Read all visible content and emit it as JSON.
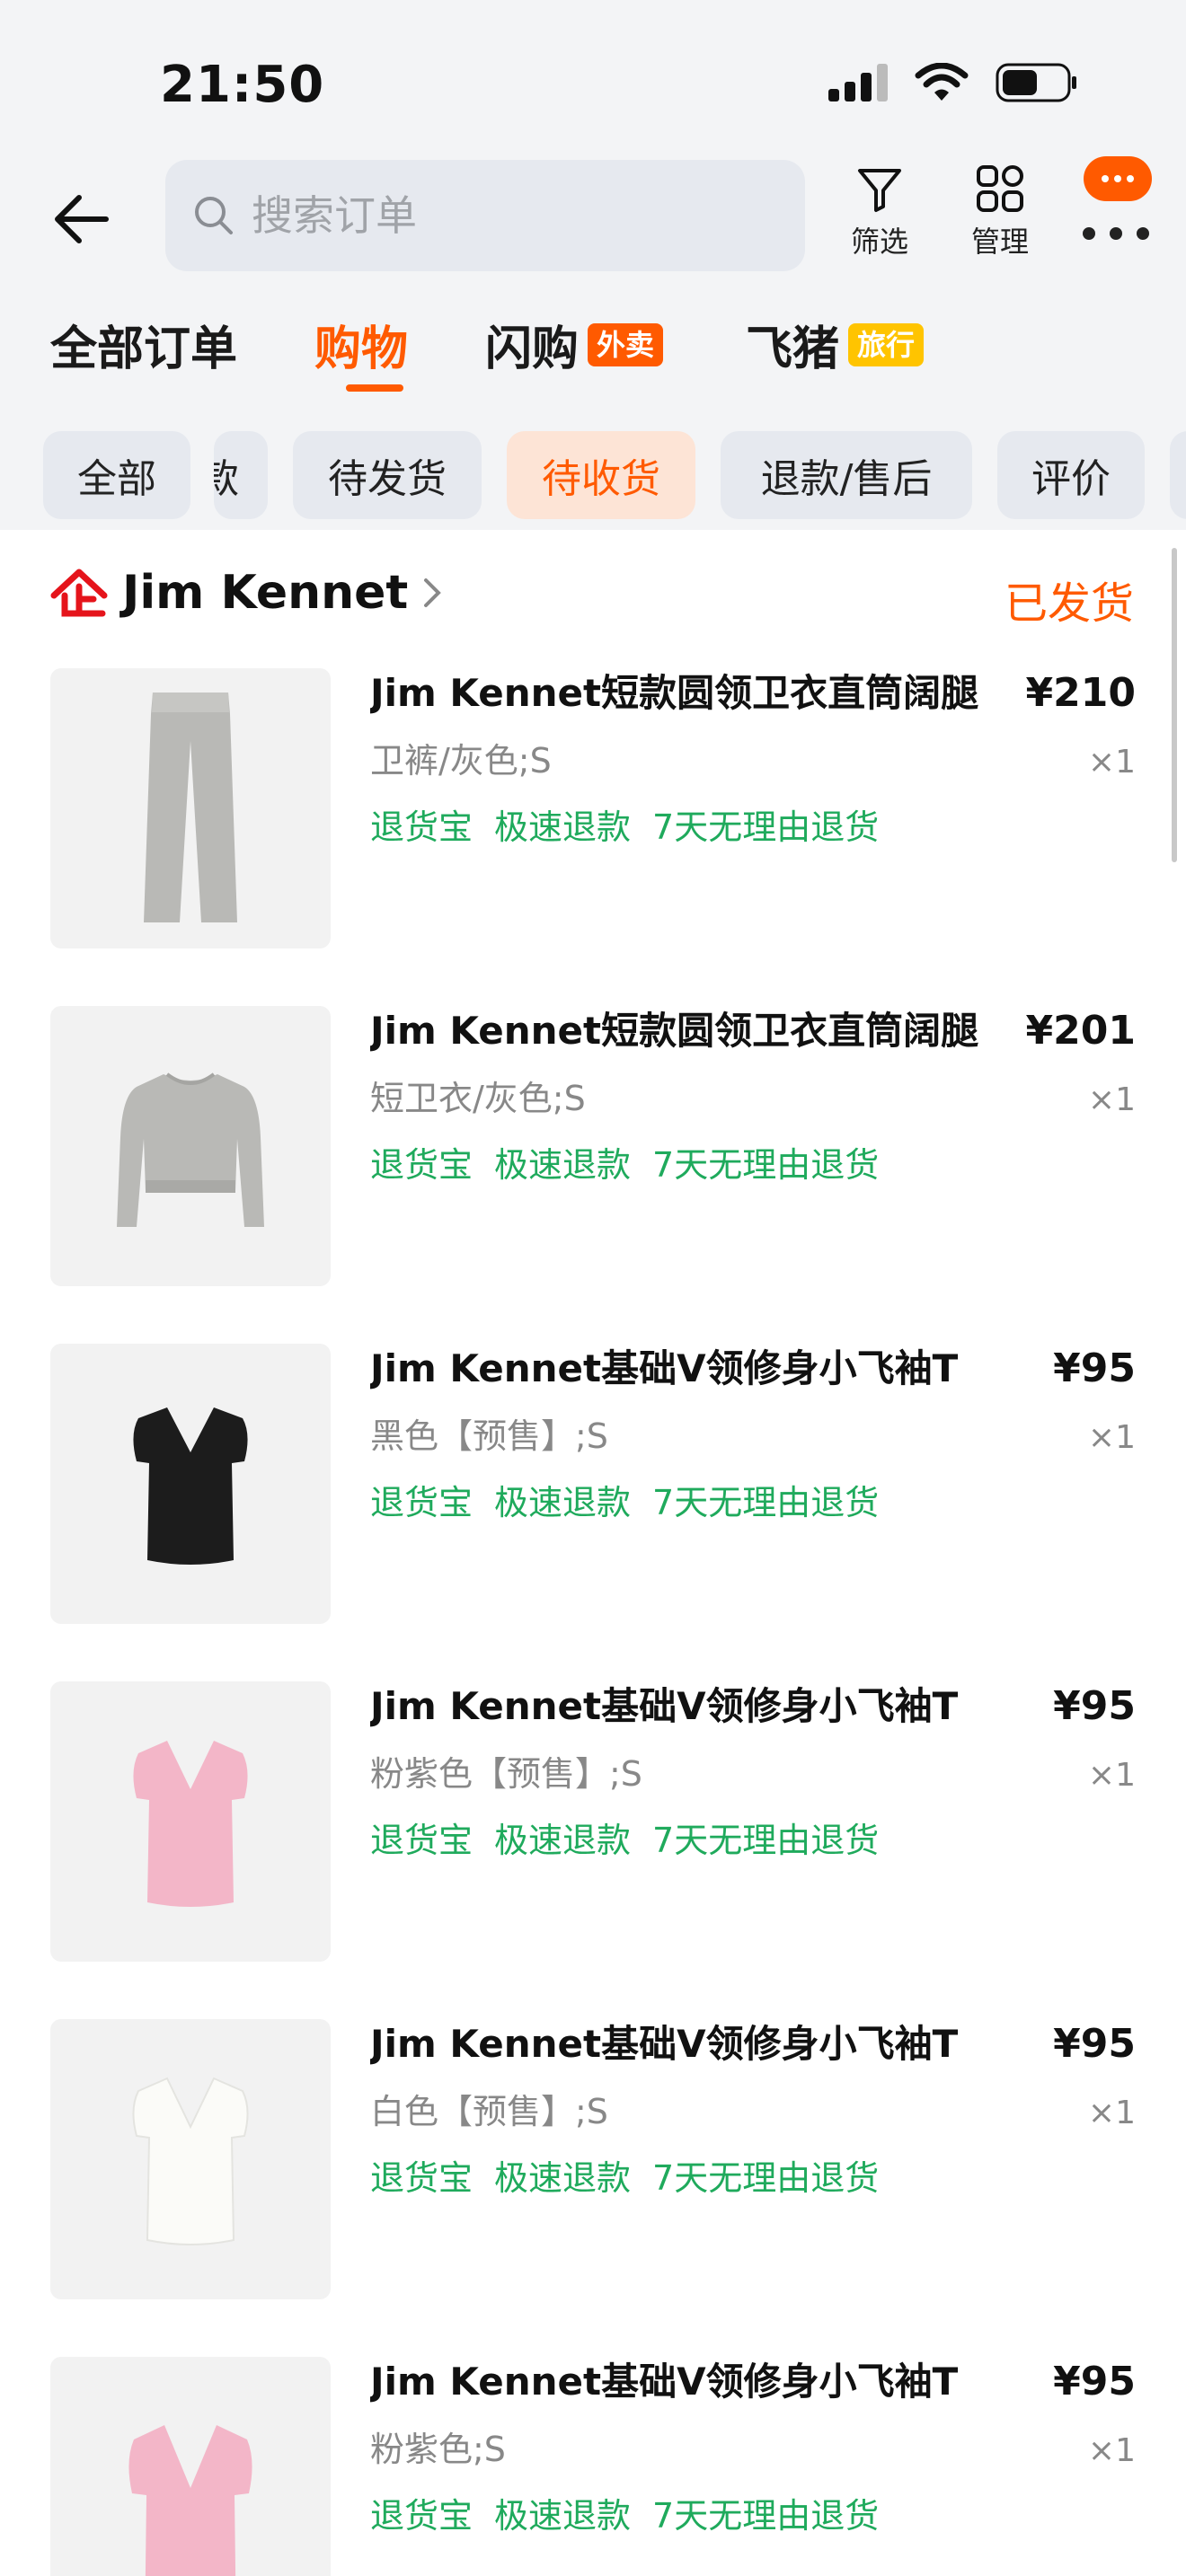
{
  "status_bar": {
    "time": "21:50"
  },
  "search": {
    "placeholder": "搜索订单"
  },
  "header_actions": {
    "filter_label": "筛选",
    "manage_label": "管理"
  },
  "top_tabs": [
    {
      "label": "全部订单"
    },
    {
      "label": "购物"
    },
    {
      "label": "闪购",
      "badge": "外卖"
    },
    {
      "label": "飞猪",
      "badge": "旅行"
    }
  ],
  "active_top_tab": "购物",
  "filter_chips": [
    {
      "label": "全部"
    },
    {
      "label": "款"
    },
    {
      "label": "待发货"
    },
    {
      "label": "待收货"
    },
    {
      "label": "退款/售后"
    },
    {
      "label": "评价"
    }
  ],
  "active_filter_chip": "待收货",
  "order": {
    "shop_name": "Jim Kennet",
    "status": "已发货",
    "items": [
      {
        "title": "Jim Kennet短款圆领卫衣直筒阔腿",
        "price": "¥210",
        "sku": "卫裤/灰色;S",
        "qty": "×1",
        "image": "gray-pants",
        "tags": [
          "退货宝",
          "极速退款",
          "7天无理由退货"
        ]
      },
      {
        "title": "Jim Kennet短款圆领卫衣直筒阔腿",
        "price": "¥201",
        "sku": "短卫衣/灰色;S",
        "qty": "×1",
        "image": "gray-sweatshirt",
        "tags": [
          "退货宝",
          "极速退款",
          "7天无理由退货"
        ]
      },
      {
        "title": "Jim Kennet基础V领修身小飞袖T",
        "price": "¥95",
        "sku": "黑色【预售】;S",
        "qty": "×1",
        "image": "black-tshirt",
        "tags": [
          "退货宝",
          "极速退款",
          "7天无理由退货"
        ]
      },
      {
        "title": "Jim Kennet基础V领修身小飞袖T",
        "price": "¥95",
        "sku": "粉紫色【预售】;S",
        "qty": "×1",
        "image": "pink-tshirt",
        "tags": [
          "退货宝",
          "极速退款",
          "7天无理由退货"
        ]
      },
      {
        "title": "Jim Kennet基础V领修身小飞袖T",
        "price": "¥95",
        "sku": "白色【预售】;S",
        "qty": "×1",
        "image": "white-tshirt",
        "tags": [
          "退货宝",
          "极速退款",
          "7天无理由退货"
        ]
      },
      {
        "title": "Jim Kennet基础V领修身小飞袖T",
        "price": "¥95",
        "sku": "粉紫色;S",
        "qty": "×1",
        "image": "pink-tshirt",
        "tags": [
          "退货宝",
          "极速退款",
          "7天无理由退货"
        ]
      }
    ]
  },
  "colors": {
    "accent": "#ff5a00",
    "tag_green": "#1faa5c",
    "badge_takeout": "#ff5a00",
    "badge_travel": "#ffc400",
    "shop_icon_red": "#e5141b",
    "active_chip_bg": "#fde4d6"
  }
}
